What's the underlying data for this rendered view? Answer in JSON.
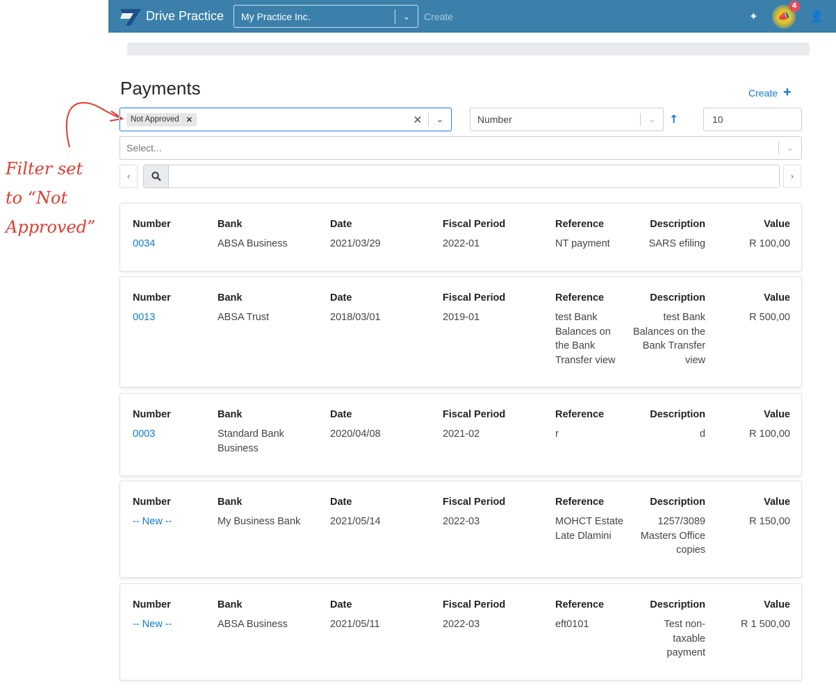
{
  "annotation": {
    "text_lines": [
      "Filter set",
      "to “Not",
      "Approved”"
    ]
  },
  "navbar": {
    "brand": "Drive Practice",
    "practice": "My Practice Inc.",
    "create": "Create",
    "notifications_count": "4",
    "icons": [
      "magic-wand-icon",
      "megaphone-icon",
      "user-icon"
    ]
  },
  "page": {
    "title": "Payments",
    "create_label": "Create"
  },
  "filters": {
    "status_chip": "Not Approved",
    "sort_by": "Number",
    "page_size": "10",
    "extra_placeholder": "Select...",
    "search_value": ""
  },
  "columns": [
    "Number",
    "Bank",
    "Date",
    "Fiscal Period",
    "Reference",
    "Description",
    "Value"
  ],
  "payments": [
    {
      "number": "0034",
      "bank": "ABSA Business",
      "date": "2021/03/29",
      "fiscal_period": "2022-01",
      "reference": "NT payment",
      "description": "SARS efiling",
      "value": "R 100,00"
    },
    {
      "number": "0013",
      "bank": "ABSA Trust",
      "date": "2018/03/01",
      "fiscal_period": "2019-01",
      "reference": "test Bank Balances on the Bank Transfer view",
      "description": "test Bank Balances on the Bank Transfer view",
      "value": "R 500,00"
    },
    {
      "number": "0003",
      "bank": "Standard Bank Business",
      "date": "2020/04/08",
      "fiscal_period": "2021-02",
      "reference": "r",
      "description": "d",
      "value": "R 100,00"
    },
    {
      "number": "-- New --",
      "bank": "My Business Bank",
      "date": "2021/05/14",
      "fiscal_period": "2022-03",
      "reference": "MOHCT Estate Late Dlamini",
      "description": "1257/3089 Masters Office copies",
      "value": "R 150,00"
    },
    {
      "number": "-- New --",
      "bank": "ABSA Business",
      "date": "2021/05/11",
      "fiscal_period": "2022-03",
      "reference": "eft0101",
      "description": "Test non-taxable payment",
      "value": "R 1 500,00"
    }
  ]
}
